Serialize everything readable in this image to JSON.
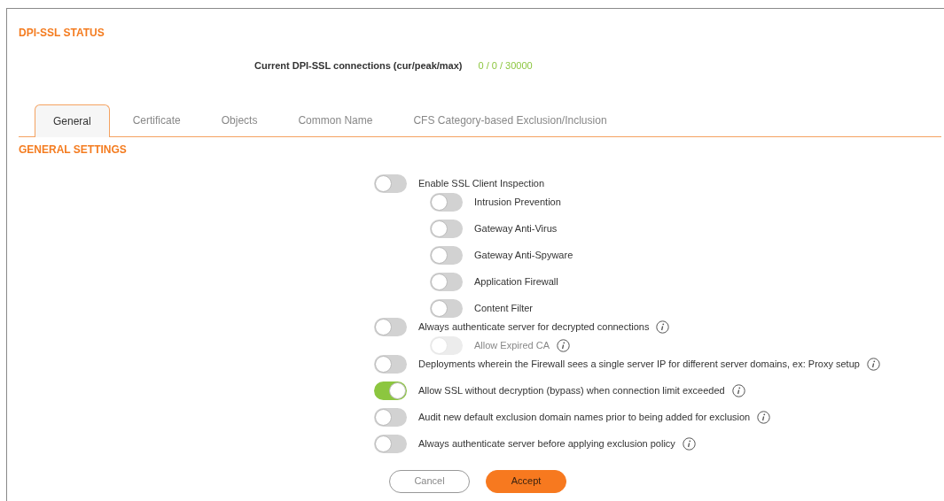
{
  "status": {
    "title": "DPI-SSL STATUS",
    "connections_label": "Current DPI-SSL connections (cur/peak/max)",
    "connections_value": "0 / 0 / 30000"
  },
  "tabs": [
    {
      "label": "General",
      "selected": true
    },
    {
      "label": "Certificate",
      "selected": false
    },
    {
      "label": "Objects",
      "selected": false
    },
    {
      "label": "Common Name",
      "selected": false
    },
    {
      "label": "CFS Category-based Exclusion/Inclusion",
      "selected": false
    }
  ],
  "section_title": "GENERAL SETTINGS",
  "settings": [
    {
      "label": "Enable SSL Client Inspection",
      "on": false,
      "disabled": false,
      "info": false,
      "children": [
        {
          "label": "Intrusion Prevention",
          "on": false,
          "disabled": false,
          "info": false
        },
        {
          "label": "Gateway Anti-Virus",
          "on": false,
          "disabled": false,
          "info": false
        },
        {
          "label": "Gateway Anti-Spyware",
          "on": false,
          "disabled": false,
          "info": false
        },
        {
          "label": "Application Firewall",
          "on": false,
          "disabled": false,
          "info": false
        },
        {
          "label": "Content Filter",
          "on": false,
          "disabled": false,
          "info": false
        }
      ]
    },
    {
      "label": "Always authenticate server for decrypted connections",
      "on": false,
      "disabled": false,
      "info": true,
      "children": [
        {
          "label": "Allow Expired CA",
          "on": false,
          "disabled": true,
          "info": true
        }
      ]
    },
    {
      "label": "Deployments wherein the Firewall sees a single server IP for different server domains, ex: Proxy setup",
      "on": false,
      "disabled": false,
      "info": true
    },
    {
      "label": "Allow SSL without decryption (bypass) when connection limit exceeded",
      "on": true,
      "disabled": false,
      "info": true
    },
    {
      "label": "Audit new default exclusion domain names prior to being added for exclusion",
      "on": false,
      "disabled": false,
      "info": true
    },
    {
      "label": "Always authenticate server before applying exclusion policy",
      "on": false,
      "disabled": false,
      "info": true
    }
  ],
  "buttons": [
    {
      "label": "Cancel",
      "kind": "secondary"
    },
    {
      "label": "Accept",
      "kind": "primary"
    }
  ]
}
